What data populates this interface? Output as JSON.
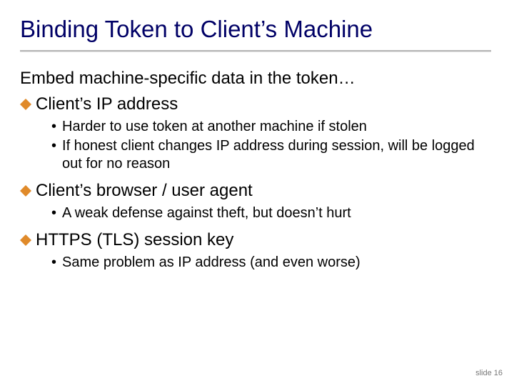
{
  "title": "Binding Token to Client’s Machine",
  "intro": "Embed machine-specific data in the token…",
  "points": [
    {
      "text": "Client’s IP address",
      "sub": [
        "Harder to use token at another machine if stolen",
        "If honest client changes IP address during session, will be logged out for no reason"
      ]
    },
    {
      "text": "Client’s browser / user agent",
      "sub": [
        "A weak defense against theft, but doesn’t hurt"
      ]
    },
    {
      "text": "HTTPS (TLS) session key",
      "sub": [
        "Same problem as IP address  (and even worse)"
      ]
    }
  ],
  "footer": "slide 16",
  "colors": {
    "diamond": "#e08a2a"
  },
  "chart_data": {
    "type": "table",
    "title": "Slide bullet content",
    "categories": [],
    "values": []
  }
}
